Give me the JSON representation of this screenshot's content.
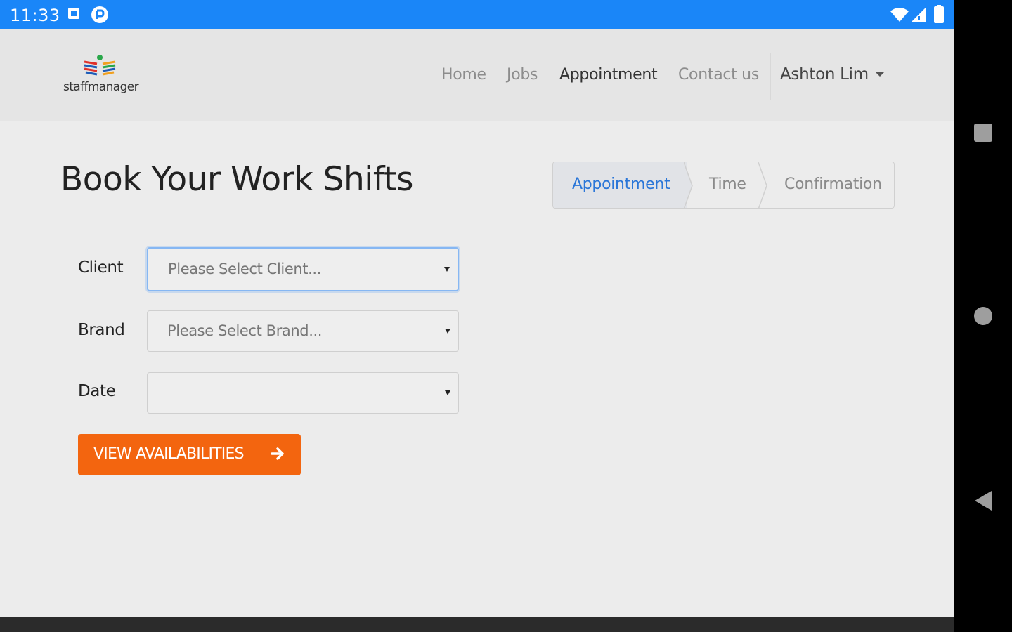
{
  "status_bar": {
    "time": "11:33"
  },
  "navbar": {
    "logo_text": "staffmanager",
    "links": [
      "Home",
      "Jobs",
      "Appointment",
      "Contact us"
    ],
    "active_link": "Appointment",
    "user_name": "Ashton Lim"
  },
  "main": {
    "title": "Book Your Work Shifts",
    "steps": [
      "Appointment",
      "Time",
      "Confirmation"
    ],
    "active_step": "Appointment",
    "form": {
      "client_label": "Client",
      "client_placeholder": "Please Select Client...",
      "brand_label": "Brand",
      "brand_placeholder": "Please Select Brand...",
      "date_label": "Date",
      "date_value": "",
      "submit_label": "VIEW AVAILABILITIES"
    }
  },
  "colors": {
    "status_bar": "#1a86f8",
    "accent_button": "#f3650f",
    "active_step_text": "#2a76d8",
    "focus_ring": "#86b7f3"
  },
  "icons": {
    "status_left": [
      "photo-notification-icon",
      "pocket-notification-icon"
    ],
    "status_right": [
      "wifi-icon",
      "signal-icon",
      "battery-icon"
    ],
    "button": "arrow-right-icon",
    "system_nav": [
      "recents-icon",
      "home-icon",
      "back-icon"
    ]
  }
}
